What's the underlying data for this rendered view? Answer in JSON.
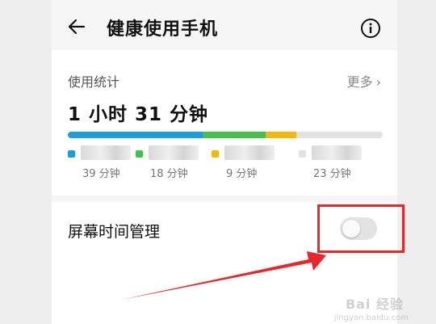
{
  "header": {
    "title": "健康使用手机",
    "back_icon": "arrow-left-icon",
    "info_icon": "info-icon"
  },
  "usage": {
    "label": "使用统计",
    "more_label": "更多",
    "total": "1 小时 31 分钟",
    "segments": [
      {
        "color": "#1a9fdc",
        "fraction": 0.429
      },
      {
        "color": "#45c04b",
        "fraction": 0.198
      },
      {
        "color": "#f4b70e",
        "fraction": 0.099
      },
      {
        "color": "#e2e2e2",
        "fraction": 0.274
      }
    ],
    "legend": [
      {
        "name": "微信",
        "time": "39 分钟",
        "color": "#1a9fdc"
      },
      {
        "name": "哔哩哔哩",
        "time": "18 分钟",
        "color": "#45c04b"
      },
      {
        "name": "欧朋浏览器",
        "time": "9 分钟",
        "color": "#f4b70e"
      },
      {
        "name": "其他",
        "time": "23 分钟",
        "color": "#e2e2e2"
      }
    ]
  },
  "screen_time": {
    "label": "屏幕时间管理",
    "toggle_on": false
  },
  "annotation": {
    "color": "#e8262b"
  },
  "watermark": {
    "text": "Bai 经验",
    "sub": "jingyan.baidu.com"
  }
}
